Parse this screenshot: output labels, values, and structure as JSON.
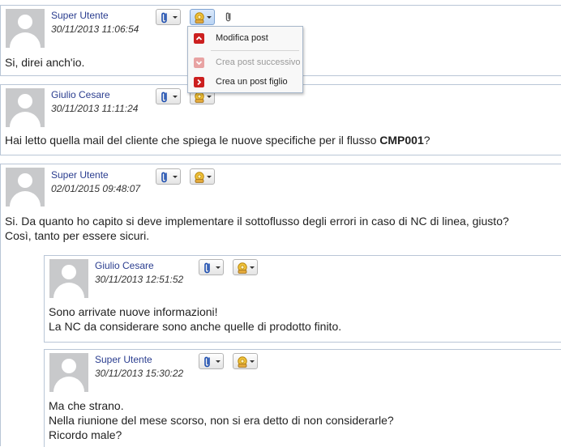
{
  "posts": [
    {
      "author": "Super Utente",
      "date": "30/11/2013 11:06:54",
      "message": "Si, direi anch'io."
    },
    {
      "author": "Giulio Cesare",
      "date": "30/11/2013 11:11:24",
      "message_prefix": "Hai letto quella mail del cliente che spiega le nuove specifiche per il flusso ",
      "message_bold": "CMP001",
      "message_suffix": "?"
    },
    {
      "author": "Super Utente",
      "date": "02/01/2015 09:48:07",
      "message_line1": "Si. Da quanto ho capito si deve implementare il sottoflusso degli errori in caso di NC di linea, giusto?",
      "message_line2": "Così, tanto per essere sicuri."
    },
    {
      "author": "Giulio Cesare",
      "date": "30/11/2013 12:51:52",
      "message_line1": "Sono arrivate nuove informazioni!",
      "message_line2": "La NC da considerare sono anche quelle di prodotto finito."
    },
    {
      "author": "Super Utente",
      "date": "30/11/2013 15:30:22",
      "message_line1": "Ma che strano.",
      "message_line2": "Nella riunione del mese scorso, non si era detto di non considerarle?",
      "message_line3": "Ricordo male?"
    }
  ],
  "menu": {
    "items": [
      {
        "label": "Modifica post",
        "enabled": true
      },
      {
        "label": "Crea post successivo",
        "enabled": false
      },
      {
        "label": "Crea un post figlio",
        "enabled": true
      }
    ]
  },
  "icons": {
    "attach": "paperclip-icon",
    "actions": "gear-hand-icon",
    "attachment_indicator": "paperclip-icon"
  },
  "colors": {
    "author": "#2a3d8f",
    "border": "#b9c6d6",
    "menu_highlight": "#cc1f1f"
  }
}
